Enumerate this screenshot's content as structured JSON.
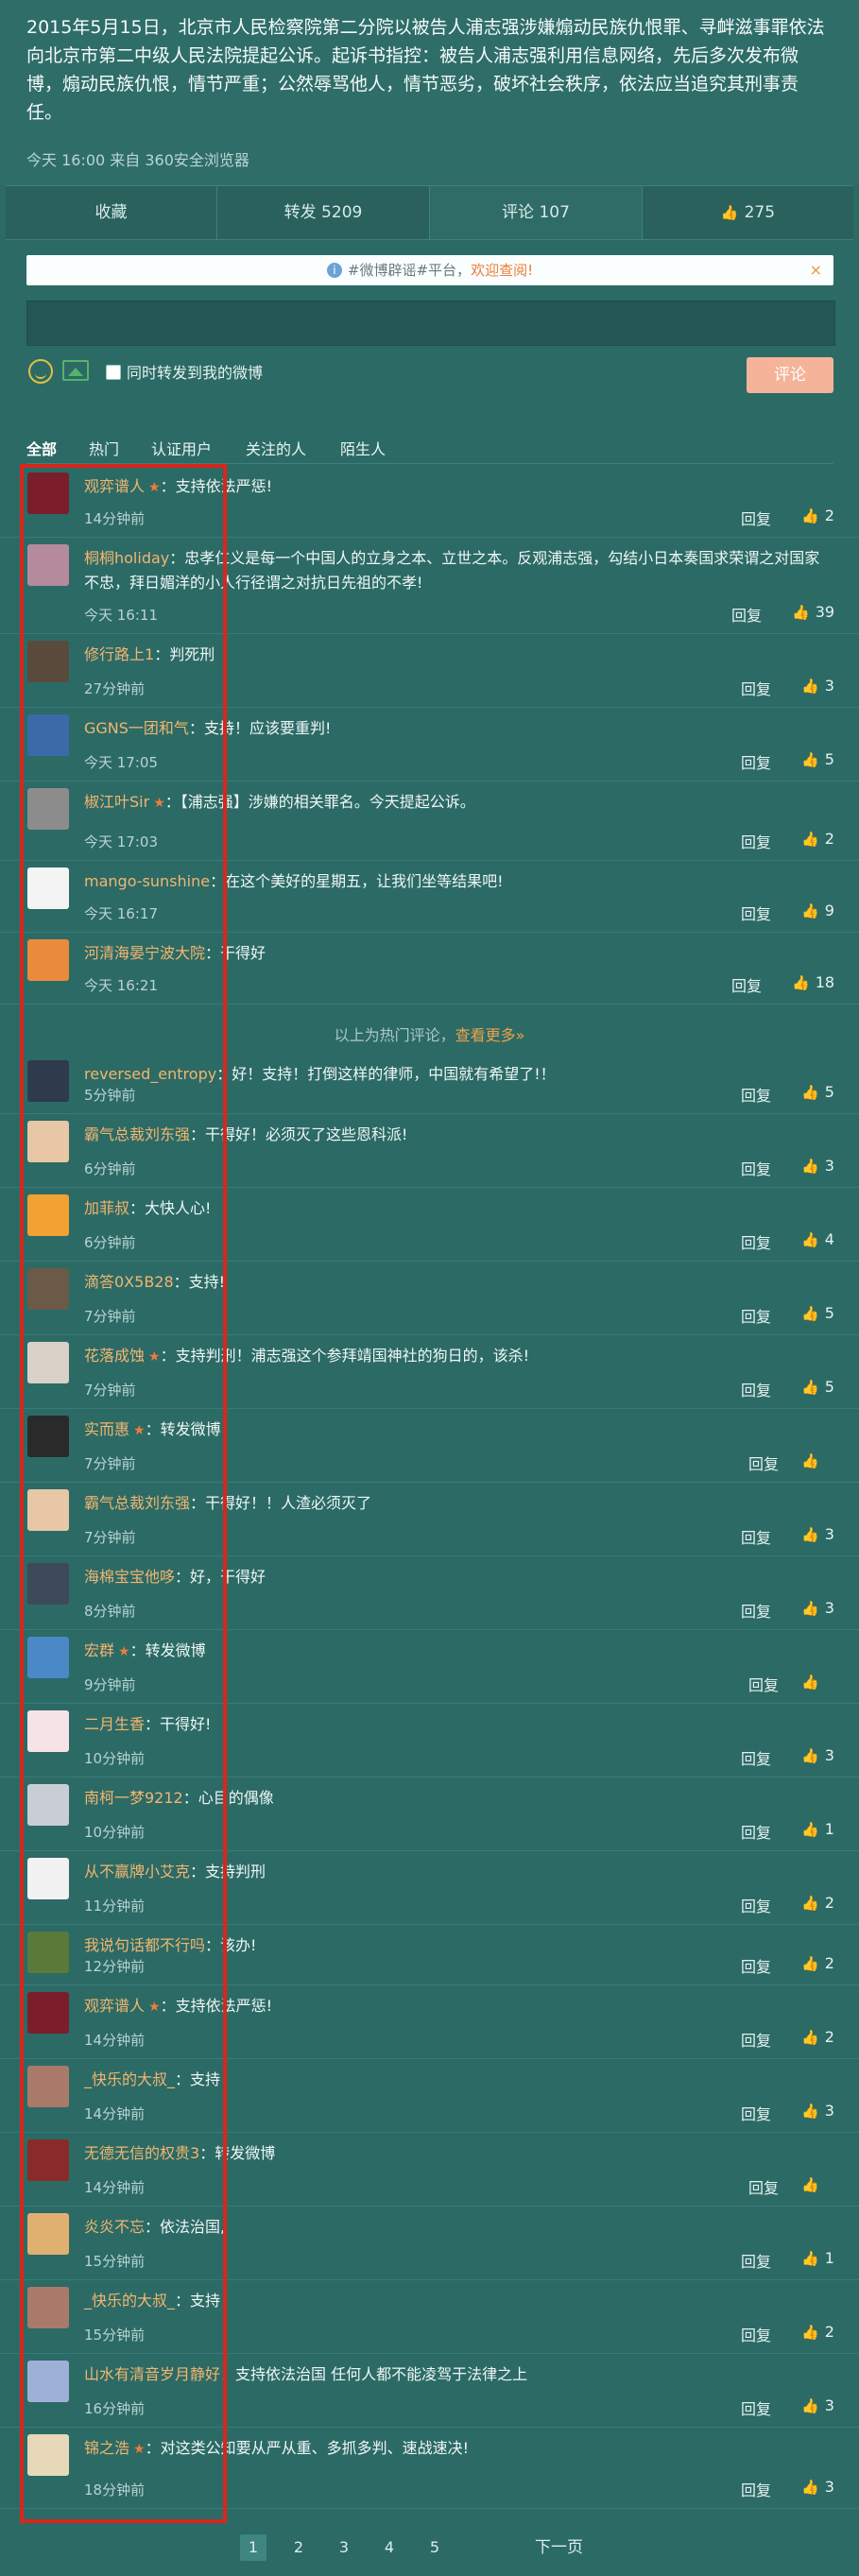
{
  "post": {
    "text": "2015年5月15日，北京市人民检察院第二分院以被告人浦志强涉嫌煽动民族仇恨罪、寻衅滋事罪依法向北京市第二中级人民法院提起公诉。起诉书指控：被告人浦志强利用信息网络，先后多次发布微博，煽动民族仇恨，情节严重；公然辱骂他人，情节恶劣，破坏社会秩序，依法应当追究其刑事责任。",
    "meta": "今天 16:00 来自 360安全浏览器"
  },
  "actions": {
    "favorite": "收藏",
    "forward": "转发 5209",
    "comment": "评论 107",
    "like": "275"
  },
  "notice": {
    "text": "#微博辟谣#平台，",
    "link": "欢迎查阅!",
    "close": "×"
  },
  "compose": {
    "forward_label": "同时转发到我的微博",
    "submit_label": "评论"
  },
  "filters": [
    "全部",
    "热门",
    "认证用户",
    "关注的人",
    "陌生人"
  ],
  "hot_footer": {
    "text": "以上为热门评论，",
    "more": "查看更多»"
  },
  "reply_label": "回复",
  "comments": [
    {
      "name": "观弈谱人",
      "vip": true,
      "text": "：支持依法严惩!",
      "time": "14分钟前",
      "likes": "2",
      "color": "#7b1d2a"
    },
    {
      "name": "桐桐holiday",
      "vip": false,
      "text": "：忠孝仁义是每一个中国人的立身之本、立世之本。反观浦志强，勾结小日本奏国求荣谓之对国家不忠，拜日媚洋的小人行径谓之对抗日先祖的不孝!",
      "time": "今天 16:11",
      "likes": "39",
      "color": "#b58a9d"
    },
    {
      "name": "修行路上1",
      "vip": false,
      "text": "：判死刑",
      "time": "27分钟前",
      "likes": "3",
      "color": "#5a4a3c"
    },
    {
      "name": "GGNS一团和气",
      "vip": false,
      "text": "：支持！应该要重判!",
      "time": "今天 17:05",
      "likes": "5",
      "color": "#3b6aa8"
    },
    {
      "name": "椒江叶Sir",
      "vip": true,
      "text": "：【浦志强】涉嫌的相关罪名。今天提起公诉。",
      "time": "今天 17:03",
      "likes": "2",
      "color": "#8c8c8c"
    },
    {
      "name": "mango-sunshine",
      "vip": false,
      "text": "：在这个美好的星期五，让我们坐等结果吧!",
      "time": "今天 16:17",
      "likes": "9",
      "color": "#f4f4f4"
    },
    {
      "name": "河清海晏宁波大院",
      "vip": false,
      "text": "：干得好",
      "time": "今天 16:21",
      "likes": "18",
      "color": "#e98b3b"
    },
    {
      "name": "reversed_entropy",
      "vip": false,
      "text": "：好！支持！打倒这样的律师，中国就有希望了!！",
      "time": "5分钟前",
      "likes": "5",
      "color": "#2d3b4d"
    },
    {
      "name": "霸气总裁刘东强",
      "vip": false,
      "text": "：干得好！必须灭了这些恩科派!",
      "time": "6分钟前",
      "likes": "3",
      "color": "#e7c7a6"
    },
    {
      "name": "加菲叔",
      "vip": false,
      "text": "：大快人心!",
      "time": "6分钟前",
      "likes": "4",
      "color": "#f2a232"
    },
    {
      "name": "滴答0X5B28",
      "vip": false,
      "text": "：支持!",
      "time": "7分钟前",
      "likes": "5",
      "color": "#6b5a48"
    },
    {
      "name": "花落成蚀",
      "vip": true,
      "text": "：支持判刑！浦志强这个参拜靖国神社的狗日的，该杀!",
      "time": "7分钟前",
      "likes": "5",
      "color": "#d9d0c8"
    },
    {
      "name": "实而惠",
      "vip": true,
      "text": "：转发微博",
      "time": "7分钟前",
      "likes": "",
      "color": "#2a2a2a"
    },
    {
      "name": "霸气总裁刘东强",
      "vip": false,
      "text": "：干得好！！人渣必须灭了",
      "time": "7分钟前",
      "likes": "3",
      "color": "#e7c7a6"
    },
    {
      "name": "海棉宝宝他哆",
      "vip": false,
      "text": "：好，干得好",
      "time": "8分钟前",
      "likes": "3",
      "color": "#3c4a5a"
    },
    {
      "name": "宏群",
      "vip": true,
      "text": "：转发微博",
      "time": "9分钟前",
      "likes": "",
      "color": "#4a88c7"
    },
    {
      "name": "二月生香",
      "vip": false,
      "text": "：干得好!",
      "time": "10分钟前",
      "likes": "3",
      "color": "#f6e3e8"
    },
    {
      "name": "南柯一梦9212",
      "vip": false,
      "text": "：心目的偶像",
      "time": "10分钟前",
      "likes": "1",
      "color": "#c9ced4"
    },
    {
      "name": "从不赢牌小艾克",
      "vip": false,
      "text": "：支持判刑",
      "time": "11分钟前",
      "likes": "2",
      "color": "#f1f1f1"
    },
    {
      "name": "我说句话都不行吗",
      "vip": false,
      "text": "：该办!",
      "time": "12分钟前",
      "likes": "2",
      "color": "#5a7a3a"
    },
    {
      "name": "观弈谱人",
      "vip": true,
      "text": "：支持依法严惩!",
      "time": "14分钟前",
      "likes": "2",
      "color": "#7b1d2a"
    },
    {
      "name": "_快乐的大叔_",
      "vip": false,
      "text": "：支持",
      "time": "14分钟前",
      "likes": "3",
      "color": "#a97a6a"
    },
    {
      "name": "无德无信的权贵3",
      "vip": false,
      "text": "：转发微博",
      "time": "14分钟前",
      "likes": "",
      "color": "#8a2a2a"
    },
    {
      "name": "炎炎不忘",
      "vip": false,
      "text": "：依法治国,",
      "time": "15分钟前",
      "likes": "1",
      "color": "#e0b070"
    },
    {
      "name": "_快乐的大叔_",
      "vip": false,
      "text": "：支持",
      "time": "15分钟前",
      "likes": "2",
      "color": "#a97a6a"
    },
    {
      "name": "山水有清音岁月静好",
      "vip": false,
      "text": "：支持依法治国 任何人都不能凌驾于法律之上",
      "time": "16分钟前",
      "likes": "3",
      "color": "#9fb0d8"
    },
    {
      "name": "锦之浩",
      "vip": true,
      "text": "：对这类公知要从严从重、多抓多判、速战速决!",
      "time": "18分钟前",
      "likes": "3",
      "color": "#e6d8b8"
    }
  ],
  "pager": {
    "pages": [
      "1",
      "2",
      "3",
      "4",
      "5"
    ],
    "next": "下一页"
  }
}
